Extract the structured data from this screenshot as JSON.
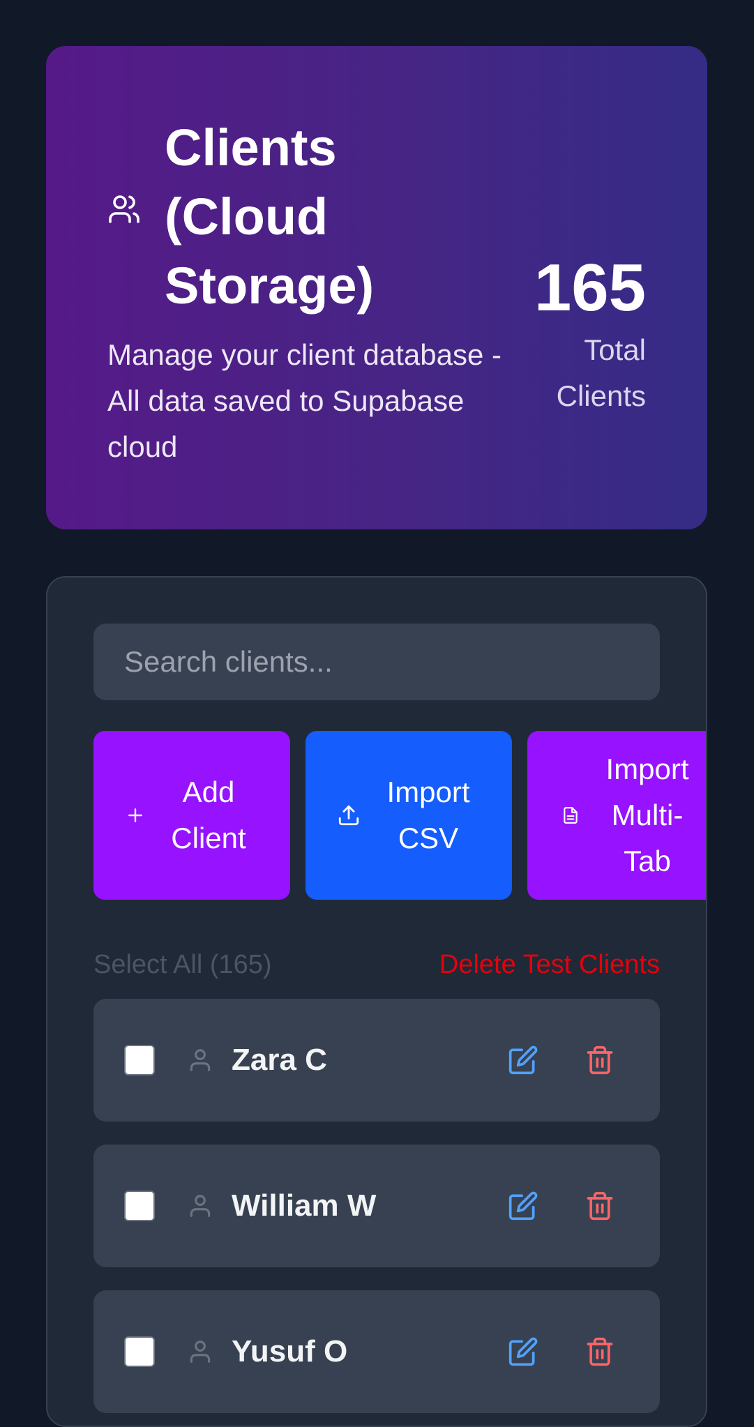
{
  "header": {
    "title": "Clients (Cloud Storage)",
    "subtitle": "Manage your client database - All data saved to Supabase cloud",
    "total_count": "165",
    "total_label": "Total Clients",
    "icon": "users-icon"
  },
  "search": {
    "placeholder": "Search clients...",
    "value": ""
  },
  "actions": {
    "add_client": "Add Client",
    "import_csv": "Import CSV",
    "import_multi_tab": "Import Multi-Tab"
  },
  "bulk": {
    "select_all": "Select All (165)",
    "delete_test": "Delete Test Clients"
  },
  "clients": [
    {
      "name": "Zara C"
    },
    {
      "name": "William W"
    },
    {
      "name": "Yusuf O"
    }
  ],
  "colors": {
    "background": "#111827",
    "hero_gradient_start": "#561a88",
    "hero_gradient_end": "#352c86",
    "panel": "#1f2937",
    "row": "#374151",
    "add_button": "#9712ff",
    "csv_button": "#155dfc",
    "multi_tab_button": "#9712ff",
    "extra_button": "#00a63e",
    "delete_text": "#e7000b",
    "edit_icon": "#51a2ff",
    "trash_icon": "#ff6467"
  }
}
